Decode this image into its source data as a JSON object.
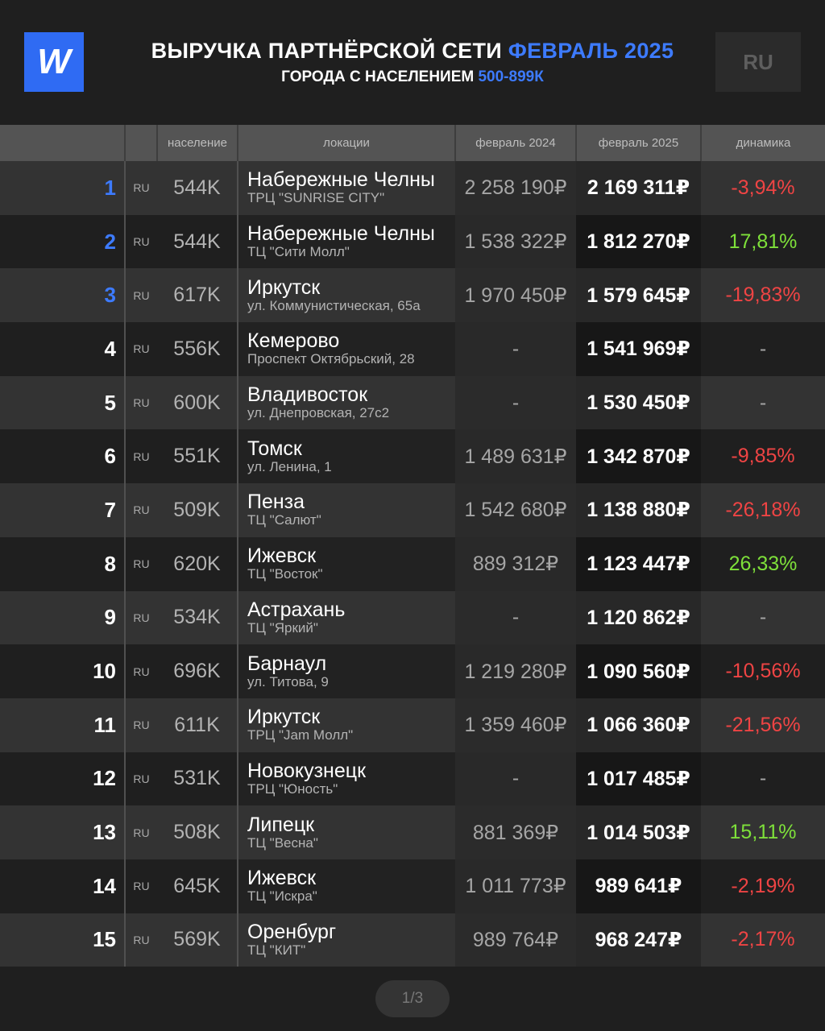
{
  "header": {
    "logo_label": "W",
    "title_main": "ВЫРУЧКА ПАРТНЁРСКОЙ СЕТИ",
    "title_accent": "ФЕВРАЛЬ 2025",
    "subtitle_main": "ГОРОДА С НАСЕЛЕНИЕМ",
    "subtitle_accent": "500-899К",
    "lang_button": "RU"
  },
  "colors": {
    "accent": "#3d7bff",
    "logo_bg": "#2f6bf3",
    "negative": "#ef4444",
    "positive": "#7ee03a"
  },
  "table": {
    "columns": [
      "",
      "",
      "население",
      "локации",
      "февраль 2024",
      "февраль 2025",
      "динамика"
    ],
    "rows": [
      {
        "rank": "1",
        "cc": "RU",
        "pop": "544K",
        "city": "Набережные Челны",
        "address": "ТРЦ \"SUNRISE CITY\"",
        "prev": "2 258 190₽",
        "cur": "2 169 311₽",
        "dyn": "-3,94%",
        "trend": "neg",
        "top": true
      },
      {
        "rank": "2",
        "cc": "RU",
        "pop": "544K",
        "city": "Набережные Челны",
        "address": "ТЦ \"Сити Молл\"",
        "prev": "1 538 322₽",
        "cur": "1 812 270₽",
        "dyn": "17,81%",
        "trend": "pos",
        "top": true
      },
      {
        "rank": "3",
        "cc": "RU",
        "pop": "617K",
        "city": "Иркутск",
        "address": "ул. Коммунистическая, 65а",
        "prev": "1 970 450₽",
        "cur": "1 579 645₽",
        "dyn": "-19,83%",
        "trend": "neg",
        "top": true
      },
      {
        "rank": "4",
        "cc": "RU",
        "pop": "556K",
        "city": "Кемерово",
        "address": "Проспект Октябрьский, 28",
        "prev": "-",
        "cur": "1 541 969₽",
        "dyn": "-",
        "trend": "none",
        "top": false
      },
      {
        "rank": "5",
        "cc": "RU",
        "pop": "600K",
        "city": "Владивосток",
        "address": "ул. Днепровская, 27с2",
        "prev": "-",
        "cur": "1 530 450₽",
        "dyn": "-",
        "trend": "none",
        "top": false
      },
      {
        "rank": "6",
        "cc": "RU",
        "pop": "551K",
        "city": "Томск",
        "address": "ул. Ленина, 1",
        "prev": "1 489 631₽",
        "cur": "1 342 870₽",
        "dyn": "-9,85%",
        "trend": "neg",
        "top": false
      },
      {
        "rank": "7",
        "cc": "RU",
        "pop": "509K",
        "city": "Пенза",
        "address": "ТЦ \"Салют\"",
        "prev": "1 542 680₽",
        "cur": "1 138 880₽",
        "dyn": "-26,18%",
        "trend": "neg",
        "top": false
      },
      {
        "rank": "8",
        "cc": "RU",
        "pop": "620K",
        "city": "Ижевск",
        "address": "ТЦ \"Восток\"",
        "prev": "889 312₽",
        "cur": "1 123 447₽",
        "dyn": "26,33%",
        "trend": "pos",
        "top": false
      },
      {
        "rank": "9",
        "cc": "RU",
        "pop": "534K",
        "city": "Астрахань",
        "address": "ТЦ \"Яркий\"",
        "prev": "-",
        "cur": "1 120 862₽",
        "dyn": "-",
        "trend": "none",
        "top": false
      },
      {
        "rank": "10",
        "cc": "RU",
        "pop": "696K",
        "city": "Барнаул",
        "address": "ул. Титова, 9",
        "prev": "1 219 280₽",
        "cur": "1 090 560₽",
        "dyn": "-10,56%",
        "trend": "neg",
        "top": false
      },
      {
        "rank": "11",
        "cc": "RU",
        "pop": "611K",
        "city": "Иркутск",
        "address": "ТРЦ \"Jam Молл\"",
        "prev": "1 359 460₽",
        "cur": "1 066 360₽",
        "dyn": "-21,56%",
        "trend": "neg",
        "top": false
      },
      {
        "rank": "12",
        "cc": "RU",
        "pop": "531K",
        "city": "Новокузнецк",
        "address": "ТРЦ \"Юность\"",
        "prev": "-",
        "cur": "1 017 485₽",
        "dyn": "-",
        "trend": "none",
        "top": false
      },
      {
        "rank": "13",
        "cc": "RU",
        "pop": "508K",
        "city": "Липецк",
        "address": "ТЦ \"Весна\"",
        "prev": "881 369₽",
        "cur": "1 014 503₽",
        "dyn": "15,11%",
        "trend": "pos",
        "top": false
      },
      {
        "rank": "14",
        "cc": "RU",
        "pop": "645K",
        "city": "Ижевск",
        "address": "ТЦ \"Искра\"",
        "prev": "1 011 773₽",
        "cur": "989 641₽",
        "dyn": "-2,19%",
        "trend": "neg",
        "top": false
      },
      {
        "rank": "15",
        "cc": "RU",
        "pop": "569K",
        "city": "Оренбург",
        "address": "ТЦ \"КИТ\"",
        "prev": "989 764₽",
        "cur": "968 247₽",
        "dyn": "-2,17%",
        "trend": "neg",
        "top": false
      }
    ]
  },
  "pager": {
    "label": "1/3"
  }
}
